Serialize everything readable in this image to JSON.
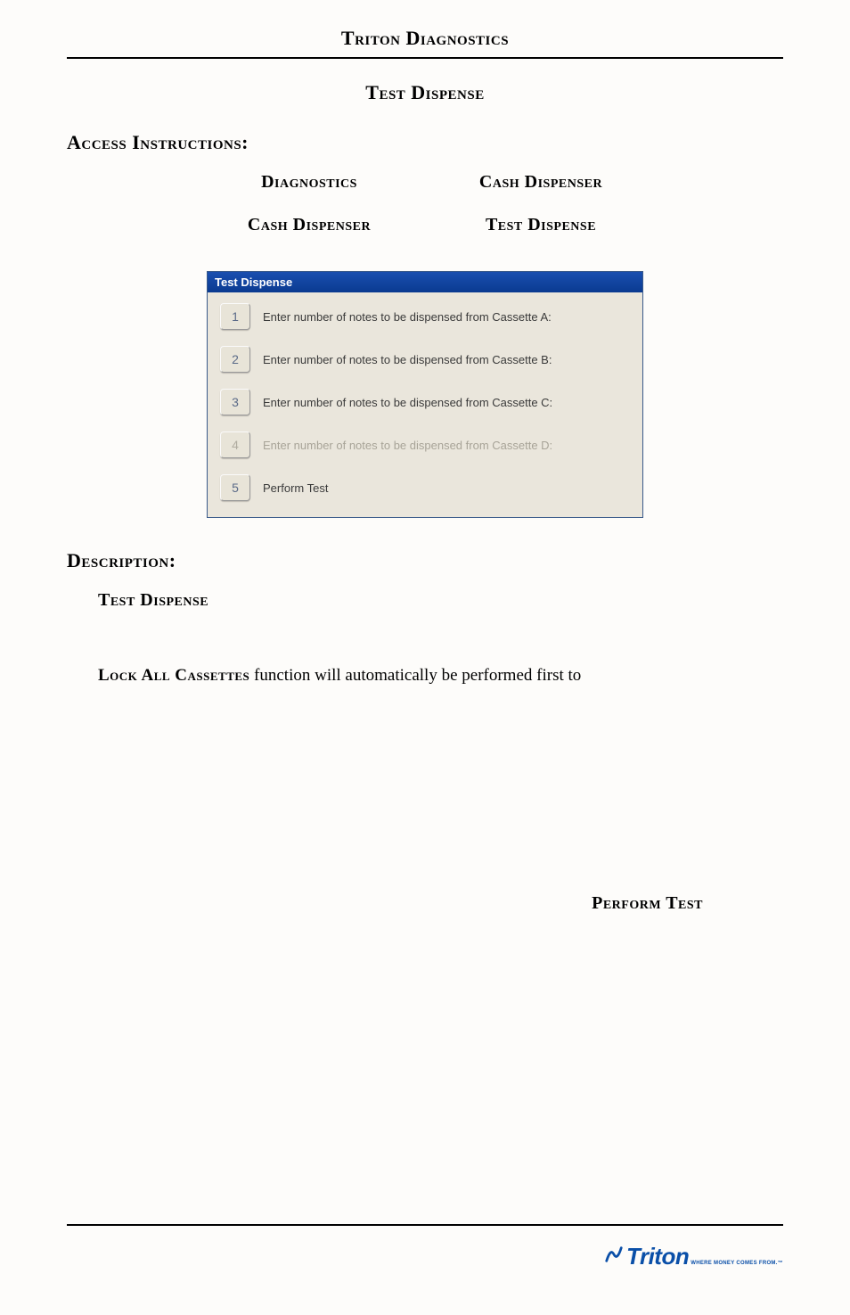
{
  "header": {
    "title": "Triton Diagnostics"
  },
  "page": {
    "title": "Test Dispense"
  },
  "access": {
    "heading": "Access Instructions:",
    "nav": [
      {
        "left": "Diagnostics",
        "right": "Cash  Dispenser"
      },
      {
        "left": "Cash Dispenser",
        "right": "Test Dispense"
      }
    ]
  },
  "dialog": {
    "title": "Test Dispense",
    "rows": [
      {
        "num": "1",
        "label": "Enter number of notes to be dispensed from Cassette A:",
        "disabled": false
      },
      {
        "num": "2",
        "label": "Enter number of notes to be dispensed from Cassette B:",
        "disabled": false
      },
      {
        "num": "3",
        "label": "Enter number of notes to be dispensed from Cassette C:",
        "disabled": false
      },
      {
        "num": "4",
        "label": "Enter number of notes to be dispensed from Cassette D:",
        "disabled": true
      },
      {
        "num": "5",
        "label": "Perform Test",
        "disabled": false
      }
    ]
  },
  "description": {
    "heading": "Description:",
    "subhead": "Test Dispense",
    "body_prefix": "Lock All Cassettes",
    "body_rest": " function will automatically be performed first to",
    "perform": "Perform Test"
  },
  "footer": {
    "logo_text": "Triton",
    "logo_tagline": "WHERE MONEY COMES FROM.™"
  }
}
